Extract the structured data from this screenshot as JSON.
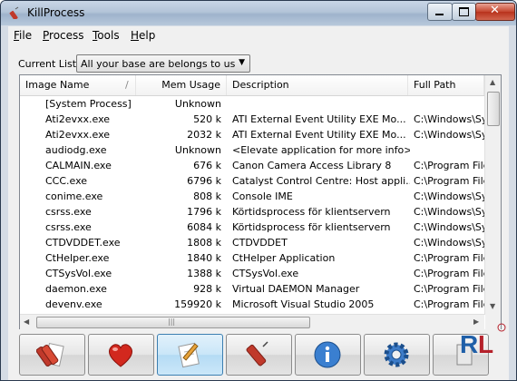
{
  "window": {
    "title": "KillProcess"
  },
  "menu": [
    {
      "mnemonic": "F",
      "rest": "ile"
    },
    {
      "mnemonic": "P",
      "rest": "rocess"
    },
    {
      "mnemonic": "T",
      "rest": "ools"
    },
    {
      "mnemonic": "H",
      "rest": "elp"
    }
  ],
  "list_selector": {
    "label": "Current List:",
    "value": "All your base are belongs to us"
  },
  "columns": [
    "Image Name",
    "Mem Usage",
    "Description",
    "Full Path"
  ],
  "rows": [
    {
      "name": "[System Process]",
      "mem": "Unknown",
      "desc": "",
      "path": ""
    },
    {
      "name": "Ati2evxx.exe",
      "mem": "520 k",
      "desc": "ATI External Event Utility EXE Mo...",
      "path": "C:\\Windows\\Sy"
    },
    {
      "name": "Ati2evxx.exe",
      "mem": "2032 k",
      "desc": "ATI External Event Utility EXE Mo...",
      "path": "C:\\Windows\\Sy"
    },
    {
      "name": "audiodg.exe",
      "mem": "Unknown",
      "desc": "<Elevate application for more info>",
      "path": ""
    },
    {
      "name": "CALMAIN.exe",
      "mem": "676 k",
      "desc": "Canon Camera Access Library 8",
      "path": "C:\\Program File"
    },
    {
      "name": "CCC.exe",
      "mem": "6796 k",
      "desc": "Catalyst Control Centre: Host appli...",
      "path": "C:\\Program File"
    },
    {
      "name": "conime.exe",
      "mem": "808 k",
      "desc": "Console IME",
      "path": "C:\\Windows\\Sy"
    },
    {
      "name": "csrss.exe",
      "mem": "1796 k",
      "desc": "Körtidsprocess för klientservern",
      "path": "C:\\Windows\\Sy"
    },
    {
      "name": "csrss.exe",
      "mem": "6084 k",
      "desc": "Körtidsprocess för klientservern",
      "path": "C:\\Windows\\Sy"
    },
    {
      "name": "CTDVDDET.exe",
      "mem": "1808 k",
      "desc": "CTDVDDET",
      "path": "C:\\Windows\\Sy"
    },
    {
      "name": "CtHelper.exe",
      "mem": "1840 k",
      "desc": "CtHelper Application",
      "path": "C:\\Program File"
    },
    {
      "name": "CTSysVol.exe",
      "mem": "1388 k",
      "desc": "CTSysVol.exe",
      "path": "C:\\Program File"
    },
    {
      "name": "daemon.exe",
      "mem": "928 k",
      "desc": "Virtual DAEMON Manager",
      "path": "C:\\Program File"
    },
    {
      "name": "devenv.exe",
      "mem": "159920 k",
      "desc": "Microsoft Visual Studio 2005",
      "path": "C:\\Program File"
    }
  ],
  "toolbar": [
    {
      "icon": "dynamite-doc-icon"
    },
    {
      "icon": "heart-icon"
    },
    {
      "icon": "edit-doc-icon"
    },
    {
      "icon": "dynamite-icon"
    },
    {
      "icon": "info-icon"
    },
    {
      "icon": "gear-icon"
    },
    {
      "icon": "exit-icon"
    }
  ],
  "watermark": {
    "text": "RL"
  }
}
